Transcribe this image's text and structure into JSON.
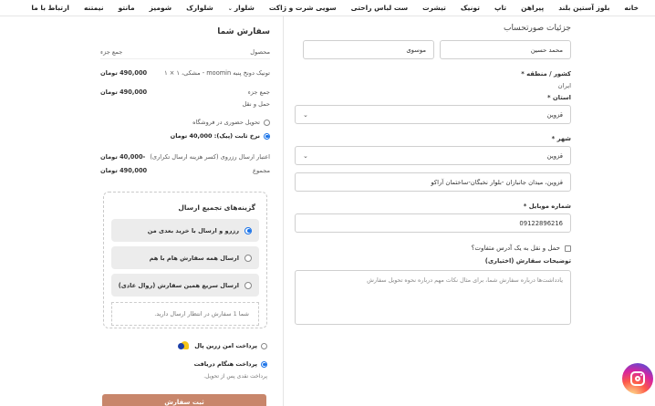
{
  "nav": {
    "items": [
      {
        "label": "خانه"
      },
      {
        "label": "بلوز آستین بلند"
      },
      {
        "label": "پیراهن"
      },
      {
        "label": "تاپ"
      },
      {
        "label": "تونیک"
      },
      {
        "label": "تیشرت"
      },
      {
        "label": "ست لباس راحتی"
      },
      {
        "label": "سویی شرت و ژاکت"
      },
      {
        "label": "شلوار"
      },
      {
        "label": "شلوارک"
      },
      {
        "label": "شومیز"
      },
      {
        "label": "مانتو"
      },
      {
        "label": "نیمتنه"
      },
      {
        "label": "ارتباط با ما"
      }
    ]
  },
  "order": {
    "title": "سفارش شما",
    "col_product": "محصول",
    "col_subtotal": "جمع جزء",
    "item_name": "تونیک دونخ پنبه moomin - مشکی، ۱ × ۱",
    "item_price": "490,000 تومان",
    "subtotal_label": "جمع جزء",
    "subtotal_value": "490,000 تومان",
    "shipping_label": "حمل و نقل",
    "ship_option_1": "تحویل حضوری در فروشگاه",
    "ship_option_2": "نرخ ثابت (پیک): 40,000 تومان",
    "credit_label": "اعتبار ارسال رزروی (کسر هزینه ارسال تکراری)",
    "credit_value": "-40,000 تومان",
    "total_label": "مجموع",
    "total_value": "490,000 تومان"
  },
  "grouping": {
    "title": "گزینه‌های تجمیع ارسال",
    "options": [
      {
        "label": "رزرو و ارسال با خرید بعدی من",
        "checked": true
      },
      {
        "label": "ارسال همه سفارش هام با هم",
        "checked": false
      },
      {
        "label": "ارسال سریع همین سفارش (روال عادی)",
        "checked": false
      }
    ],
    "note": "شما 1 سفارش در انتظار ارسال دارید."
  },
  "payment": {
    "option_1": "پرداخت امن زرین پال",
    "option_2": "پرداخت هنگام دریافت",
    "option_2_note": "پرداخت نقدی پس از تحویل.",
    "submit_label": "ثبت سفارش"
  },
  "billing": {
    "title": "جزئیات صورتحساب",
    "first_name": "محمد حسین",
    "last_name": "موسوی",
    "country_label": "کشور / منطقه *",
    "country_value": "ایران",
    "province_label": "استان *",
    "province_value": "قزوین",
    "city_label": "شهر *",
    "city_value": "قزوین",
    "address_value": "قزوین، میدان جانبازان -بلوار نخبگان-ساختمان آراکو",
    "phone_label": "شماره موبایل *",
    "phone_value": "09122896216",
    "ship_diff_label": "حمل و نقل به یک آدرس متفاوت؟",
    "notes_label": "توضیحات سفارش (اختیاری)",
    "notes_placeholder": "یادداشت‌ها درباره سفارش شما، برای مثال نکات مهم درباره نحوه تحویل سفارش"
  },
  "icons": {
    "select_chevron": "chevron-down-icon",
    "nav_caret": "chevron-down-icon",
    "social": "instagram-icon",
    "payment_logo": "zarinpal-logo"
  },
  "colors": {
    "accent_blue": "#1a73e8",
    "submit_button": "#c8866b"
  }
}
